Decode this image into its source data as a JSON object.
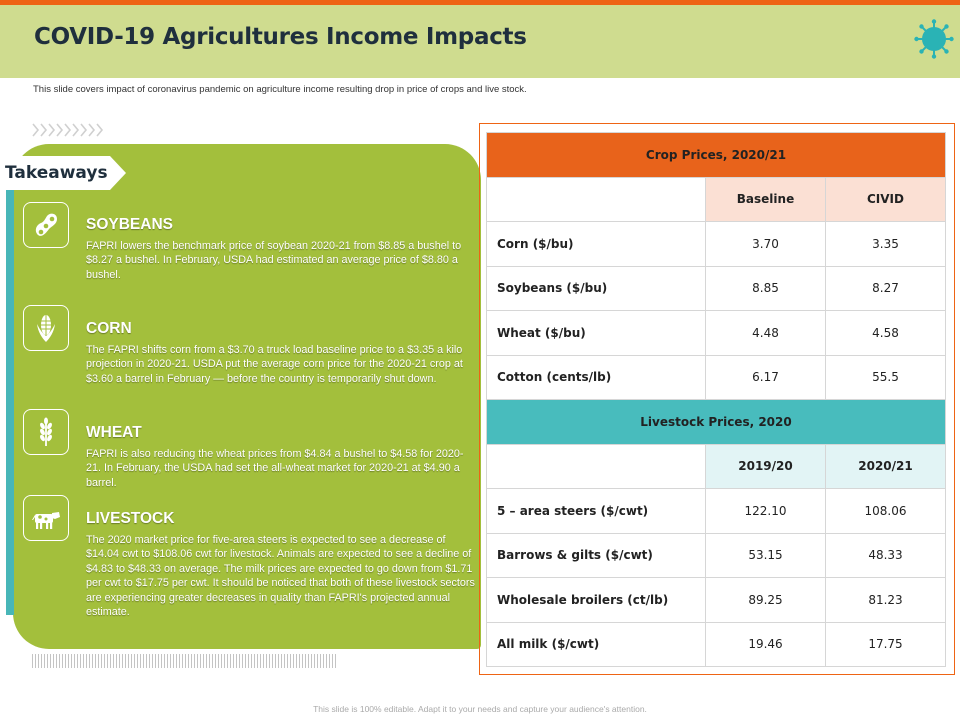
{
  "colors": {
    "accent_orange": "#ee6414",
    "header_green": "#cfdc8f",
    "panel_green": "#a3bf3c",
    "teal": "#48bcbd"
  },
  "header": {
    "title": "COVID-19 Agricultures Income Impacts",
    "icon": "virus-icon"
  },
  "subtitle": "This slide covers impact of coronavirus pandemic on agriculture income resulting drop in price of crops and live stock.",
  "takeaways": {
    "label": "Takeaways",
    "sections": [
      {
        "title": "SOYBEANS",
        "icon": "soybean-icon",
        "body": "FAPRI lowers the benchmark price of soybean 2020-21 from $8.85 a bushel to $8.27 a bushel. In February, USDA had estimated an average price of $8.80 a bushel."
      },
      {
        "title": "CORN",
        "icon": "corn-icon",
        "body": "The FAPRI shifts corn from a $3.70 a truck load baseline price to a $3.35 a kilo projection in 2020-21. USDA put the average corn price for the 2020-21 crop at $3.60 a barrel in February — before the country is temporarily shut down."
      },
      {
        "title": "WHEAT",
        "icon": "wheat-icon",
        "body": "FAPRI is also reducing the wheat prices from $4.84 a bushel to $4.58 for 2020-21. In February, the USDA had set the all-wheat market for 2020-21 at $4.90 a barrel."
      },
      {
        "title": "LIVESTOCK",
        "icon": "cow-icon",
        "body": "The 2020 market price for five-area steers is expected to see a decrease of $14.04 cwt to $108.06 cwt for livestock. Animals are expected to see a decline of $4.83 to $48.33 on average. The milk prices are expected to go down from $1.71 per cwt to $17.75 per cwt. It should be noticed that both of these livestock sectors are experiencing greater decreases in quality than FAPRI's projected annual estimate."
      }
    ]
  },
  "crop_table": {
    "title": "Crop Prices, 2020/21",
    "columns": [
      "Baseline",
      "CIVID"
    ],
    "rows": [
      {
        "label": "Corn ($/bu)",
        "values": [
          "3.70",
          "3.35"
        ]
      },
      {
        "label": "Soybeans ($/bu)",
        "values": [
          "8.85",
          "8.27"
        ]
      },
      {
        "label": "Wheat ($/bu)",
        "values": [
          "4.48",
          "4.58"
        ]
      },
      {
        "label": "Cotton (cents/lb)",
        "values": [
          "6.17",
          "55.5"
        ]
      }
    ]
  },
  "livestock_table": {
    "title": "Livestock Prices, 2020",
    "columns": [
      "2019/20",
      "2020/21"
    ],
    "rows": [
      {
        "label": "5 – area steers ($/cwt)",
        "values": [
          "122.10",
          "108.06"
        ]
      },
      {
        "label": "Barrows & gilts ($/cwt)",
        "values": [
          "53.15",
          "48.33"
        ]
      },
      {
        "label": "Wholesale broilers (ct/lb)",
        "values": [
          "89.25",
          "81.23"
        ]
      },
      {
        "label": "All milk ($/cwt)",
        "values": [
          "19.46",
          "17.75"
        ]
      }
    ]
  },
  "footer": "This slide is 100% editable. Adapt it to your needs and capture your audience's attention."
}
